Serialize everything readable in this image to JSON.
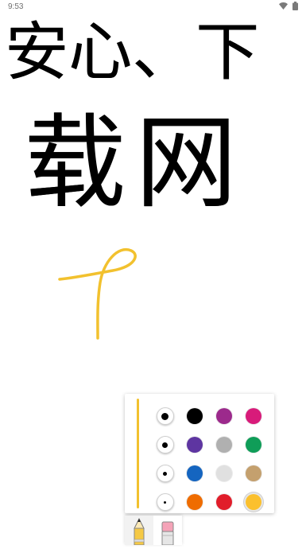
{
  "status_bar": {
    "time": "9:53",
    "icons": [
      "wifi-icon",
      "battery-icon"
    ]
  },
  "canvas": {
    "line1": "安心、下",
    "line2": "载网",
    "ink_color": "#000000",
    "accent_stroke_color": "#f2c12e"
  },
  "palette": {
    "slider_color": "#f2c12e",
    "rows": [
      {
        "size": "size-large",
        "colors": [
          "#000000",
          "#9c2a8c",
          "#d81b7a"
        ]
      },
      {
        "size": "size-medium-large",
        "colors": [
          "#5e35a1",
          "#b0b0b0",
          "#0f9d58"
        ]
      },
      {
        "size": "size-medium",
        "colors": [
          "#1565c0",
          "#e0e0e0",
          "#c4a06e"
        ]
      },
      {
        "size": "size-small",
        "colors": [
          "#ef6c00",
          "#e11d2a",
          "#fbc02d"
        ]
      }
    ],
    "selected_color": "#fbc02d"
  },
  "tools": {
    "items": [
      "pen-tool",
      "eraser-tool"
    ],
    "active": "pen-tool"
  }
}
